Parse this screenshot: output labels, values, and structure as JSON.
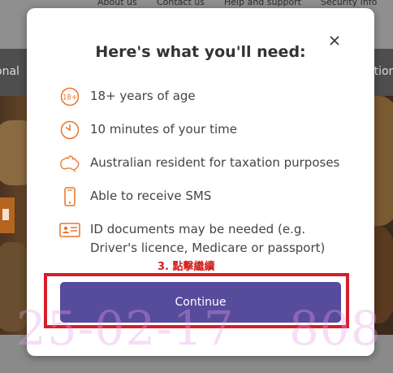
{
  "top_links": [
    "About us",
    "Contact us",
    "Help and support",
    "Security info"
  ],
  "nav": {
    "left_fragment": "onal",
    "right_fragment": "ation"
  },
  "modal": {
    "title": "Here's what you'll need:",
    "close_label": "×",
    "requirements": [
      {
        "icon": "age-18-plus-icon",
        "text": "18+ years of age"
      },
      {
        "icon": "clock-icon",
        "text": "10 minutes of your time"
      },
      {
        "icon": "australia-map-icon",
        "text": "Australian resident for taxation purposes"
      },
      {
        "icon": "mobile-phone-icon",
        "text": "Able to receive SMS"
      },
      {
        "icon": "id-card-icon",
        "text": "ID documents may be needed (e.g. Driver's licence, Medicare or passport)"
      }
    ],
    "continue_label": "Continue",
    "icon_text_18": "18+"
  },
  "annotation": {
    "text": "3. 點擊繼續"
  },
  "watermark": {
    "date": "25-02-17",
    "number": "808"
  },
  "colors": {
    "accent_orange": "#e8742a",
    "button_purple": "#574b9c",
    "highlight_red": "#d71d2b"
  }
}
